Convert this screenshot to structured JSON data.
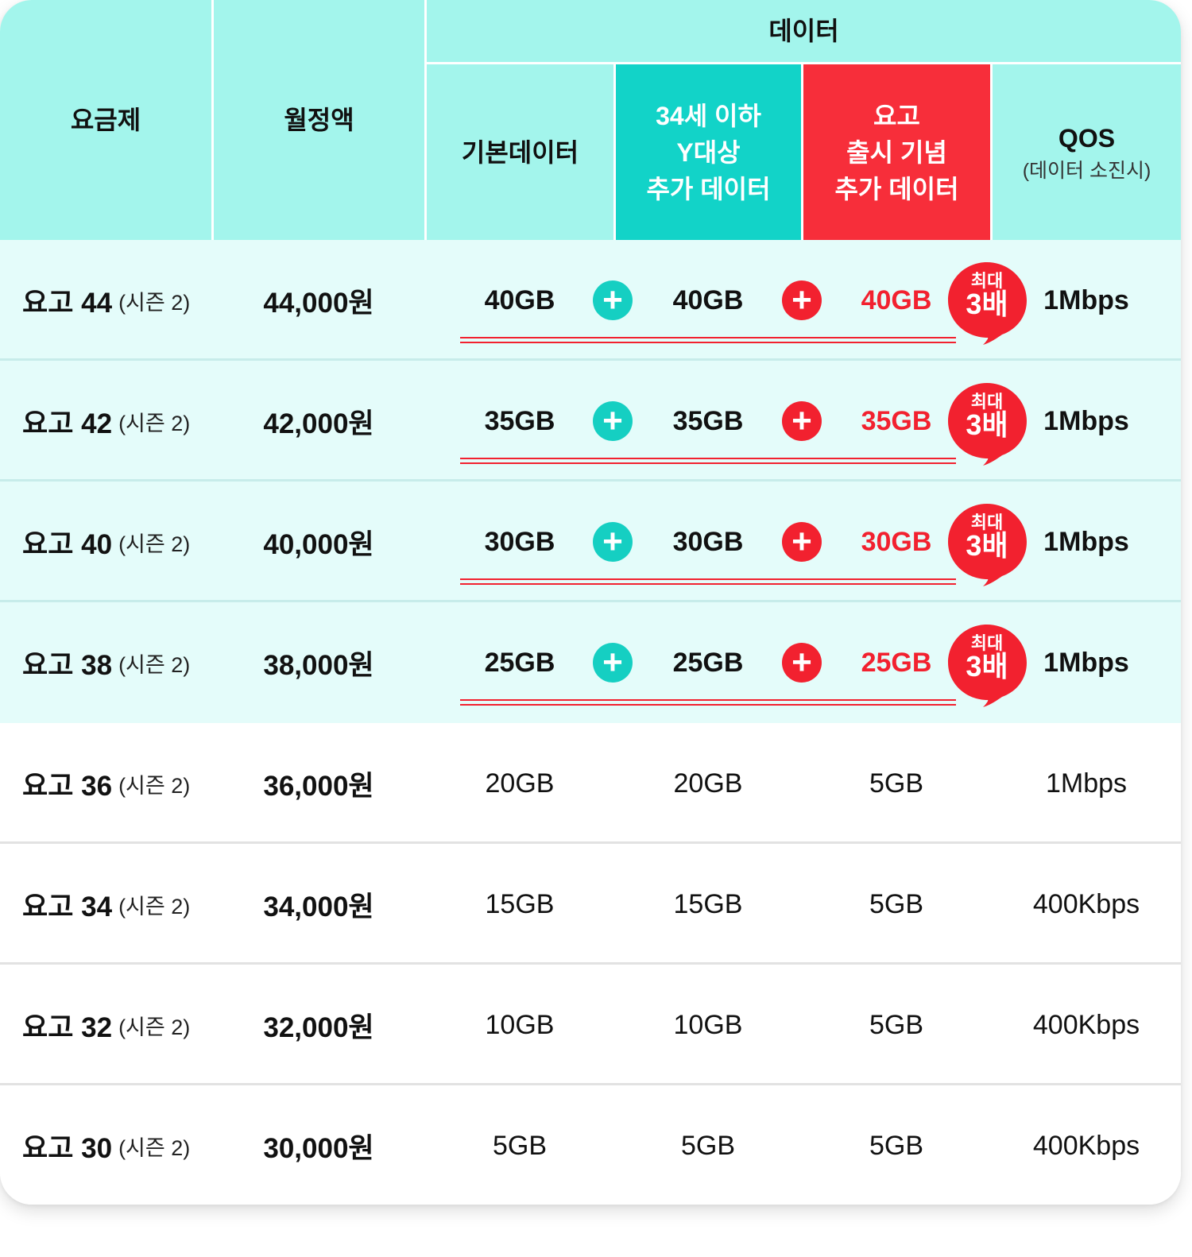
{
  "header": {
    "plan": "요금제",
    "monthly_fee": "월정액",
    "data": "데이터",
    "basic_data": "기본데이터",
    "y_bonus": [
      "34세 이하",
      "Y대상",
      "추가 데이터"
    ],
    "launch_bonus": [
      "요고",
      "출시 기념",
      "추가 데이터"
    ],
    "qos": "QOS",
    "qos_note": "(데이터 소진시)"
  },
  "badge": {
    "line1": "최대",
    "line2": "3배"
  },
  "plus_symbol": "+",
  "colors": {
    "header_bg": "#a3f5ec",
    "y_header": "#12d3c8",
    "launch_header": "#f72e3a",
    "row_highlight": "#e4fcfa",
    "accent_red": "#f2212f",
    "accent_teal": "#15cfc2"
  },
  "rows": [
    {
      "plan": "요고 44",
      "season": "(시즌 2)",
      "price": "44,000원",
      "basic": "40GB",
      "y": "40GB",
      "launch": "40GB",
      "qos": "1Mbps"
    },
    {
      "plan": "요고 42",
      "season": "(시즌 2)",
      "price": "42,000원",
      "basic": "35GB",
      "y": "35GB",
      "launch": "35GB",
      "qos": "1Mbps"
    },
    {
      "plan": "요고 40",
      "season": "(시즌 2)",
      "price": "40,000원",
      "basic": "30GB",
      "y": "30GB",
      "launch": "30GB",
      "qos": "1Mbps"
    },
    {
      "plan": "요고 38",
      "season": "(시즌 2)",
      "price": "38,000원",
      "basic": "25GB",
      "y": "25GB",
      "launch": "25GB",
      "qos": "1Mbps"
    },
    {
      "plan": "요고 36",
      "season": "(시즌 2)",
      "price": "36,000원",
      "basic": "20GB",
      "y": "20GB",
      "launch": "5GB",
      "qos": "1Mbps"
    },
    {
      "plan": "요고 34",
      "season": "(시즌 2)",
      "price": "34,000원",
      "basic": "15GB",
      "y": "15GB",
      "launch": "5GB",
      "qos": "400Kbps"
    },
    {
      "plan": "요고 32",
      "season": "(시즌 2)",
      "price": "32,000원",
      "basic": "10GB",
      "y": "10GB",
      "launch": "5GB",
      "qos": "400Kbps"
    },
    {
      "plan": "요고 30",
      "season": "(시즌 2)",
      "price": "30,000원",
      "basic": "5GB",
      "y": "5GB",
      "launch": "5GB",
      "qos": "400Kbps"
    }
  ]
}
